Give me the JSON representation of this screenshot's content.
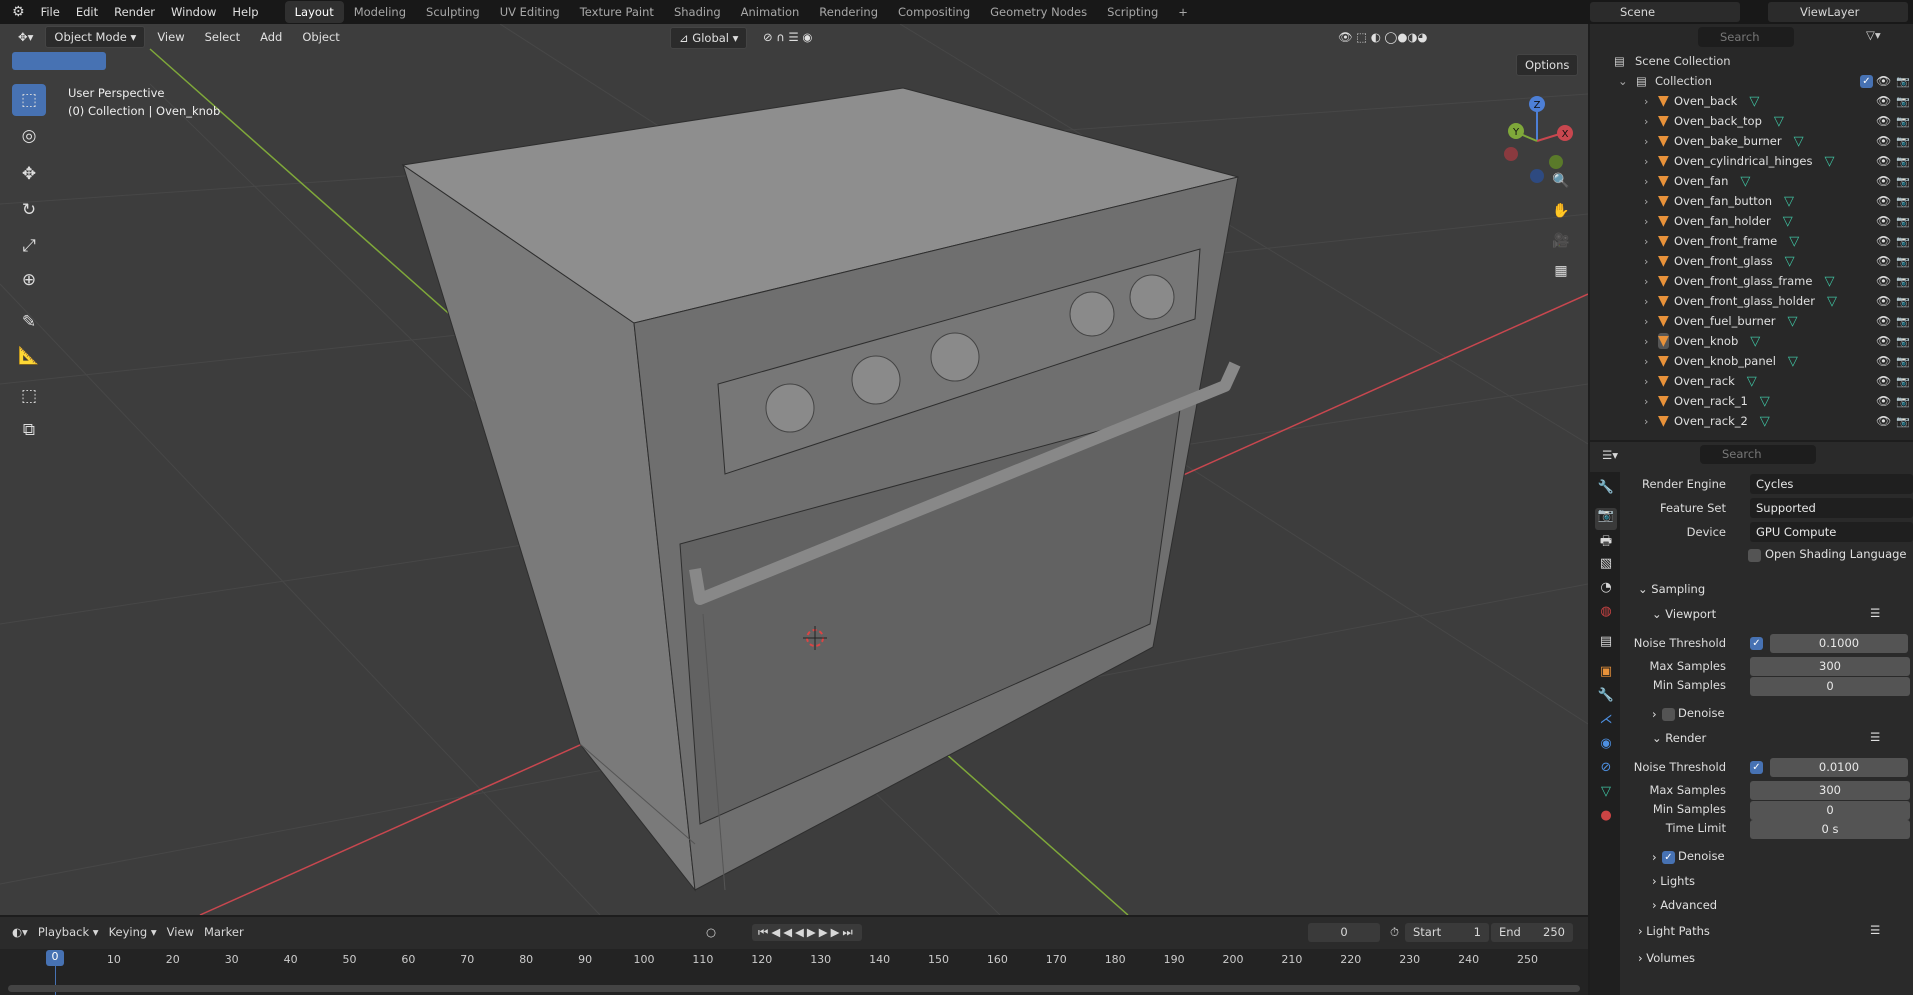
{
  "topbar": {
    "menus": [
      "File",
      "Edit",
      "Render",
      "Window",
      "Help"
    ],
    "workspaces": [
      "Layout",
      "Modeling",
      "Sculpting",
      "UV Editing",
      "Texture Paint",
      "Shading",
      "Animation",
      "Rendering",
      "Compositing",
      "Geometry Nodes",
      "Scripting"
    ],
    "active_workspace": "Layout",
    "scene": "Scene",
    "view_layer": "ViewLayer"
  },
  "viewport": {
    "mode": "Object Mode",
    "menus": [
      "View",
      "Select",
      "Add",
      "Object"
    ],
    "orientation": "Global",
    "options": "Options",
    "perspective": "User Perspective",
    "context": "(0) Collection | Oven_knob",
    "gizmo": {
      "x": "X",
      "y": "Y",
      "z": "Z"
    }
  },
  "outliner": {
    "search_placeholder": "Search",
    "scene_collection": "Scene Collection",
    "collection": "Collection",
    "objects": [
      "Oven_back",
      "Oven_back_top",
      "Oven_bake_burner",
      "Oven_cylindrical_hinges",
      "Oven_fan",
      "Oven_fan_button",
      "Oven_fan_holder",
      "Oven_front_frame",
      "Oven_front_glass",
      "Oven_front_glass_frame",
      "Oven_front_glass_holder",
      "Oven_fuel_burner",
      "Oven_knob",
      "Oven_knob_panel",
      "Oven_rack",
      "Oven_rack_1",
      "Oven_rack_2"
    ],
    "active": "Oven_knob"
  },
  "properties": {
    "search_placeholder": "Search",
    "render_engine_label": "Render Engine",
    "render_engine": "Cycles",
    "feature_set_label": "Feature Set",
    "feature_set": "Supported",
    "device_label": "Device",
    "device": "GPU Compute",
    "osl_label": "Open Shading Language",
    "sampling": "Sampling",
    "viewport": "Viewport",
    "render": "Render",
    "noise_threshold_label": "Noise Threshold",
    "viewport_noise_threshold": "0.1000",
    "max_samples_label": "Max Samples",
    "viewport_max_samples": "300",
    "min_samples_label": "Min Samples",
    "viewport_min_samples": "0",
    "denoise_label": "Denoise",
    "render_noise_threshold": "0.0100",
    "render_max_samples": "300",
    "render_min_samples": "0",
    "time_limit_label": "Time Limit",
    "time_limit": "0 s",
    "lights": "Lights",
    "advanced": "Advanced",
    "light_paths": "Light Paths",
    "volumes": "Volumes"
  },
  "timeline": {
    "menus": [
      "Playback",
      "Keying",
      "View",
      "Marker"
    ],
    "current_frame": "0",
    "start_label": "Start",
    "start": "1",
    "end_label": "End",
    "end": "250",
    "ticks": [
      "0",
      "10",
      "20",
      "30",
      "40",
      "50",
      "60",
      "70",
      "80",
      "90",
      "100",
      "110",
      "120",
      "130",
      "140",
      "150",
      "160",
      "170",
      "180",
      "190",
      "200",
      "210",
      "220",
      "230",
      "240",
      "250"
    ]
  },
  "colors": {
    "accent": "#4772b3",
    "object": "#e8923a",
    "mesh": "#3fc1a0",
    "x_axis": "#c8474f",
    "y_axis": "#7fa83a"
  }
}
